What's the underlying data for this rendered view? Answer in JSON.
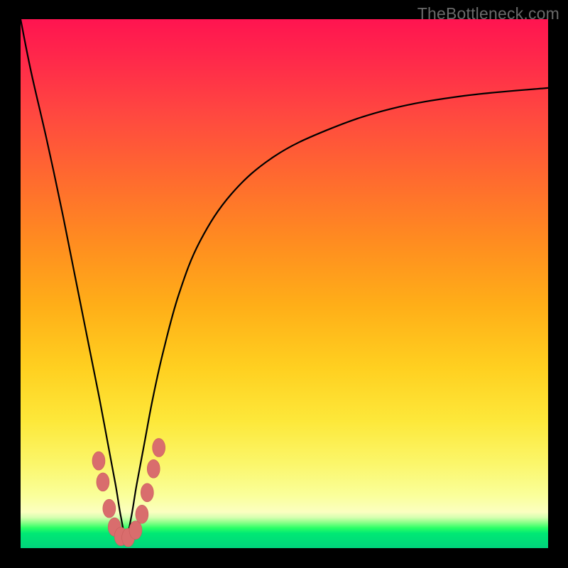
{
  "watermark": "TheBottleneck.com",
  "colors": {
    "frame": "#000000",
    "curve": "#000000",
    "bead_fill": "#d96d6d",
    "bead_stroke": "#c85c5c",
    "gradient_top": "#ff1450",
    "gradient_bottom": "#00d47c"
  },
  "chart_data": {
    "type": "line",
    "title": "",
    "xlabel": "",
    "ylabel": "",
    "xlim": [
      0,
      100
    ],
    "ylim": [
      0,
      100
    ],
    "note": "No numeric axes or tick labels are rendered in the image. x/y values below are estimated in percent of the plot area (0–100 each axis) with (0,0) at bottom-left, approximating the V-shaped curve with minimum near x≈20.",
    "series": [
      {
        "name": "curve",
        "x": [
          0,
          2,
          5,
          8,
          11,
          13,
          15,
          16.5,
          18,
          19,
          20,
          21,
          22,
          23.5,
          25,
          27,
          30,
          34,
          40,
          48,
          58,
          70,
          84,
          100
        ],
        "y": [
          100,
          90,
          77,
          63,
          48,
          38,
          28,
          20,
          12,
          6,
          2,
          6,
          12,
          20,
          28,
          37,
          48,
          58,
          67,
          74,
          79,
          83,
          85.5,
          87
        ]
      }
    ],
    "markers": {
      "name": "beads",
      "note": "Pink oval markers clustered around the curve's valley near the bottom of the plot.",
      "points_percent_xy": [
        [
          14.8,
          16.5
        ],
        [
          15.6,
          12.5
        ],
        [
          16.8,
          7.5
        ],
        [
          17.8,
          4.0
        ],
        [
          19.0,
          2.2
        ],
        [
          20.4,
          2.0
        ],
        [
          21.8,
          3.4
        ],
        [
          23.0,
          6.4
        ],
        [
          24.0,
          10.5
        ],
        [
          25.2,
          15.0
        ],
        [
          26.2,
          19.0
        ]
      ]
    }
  }
}
